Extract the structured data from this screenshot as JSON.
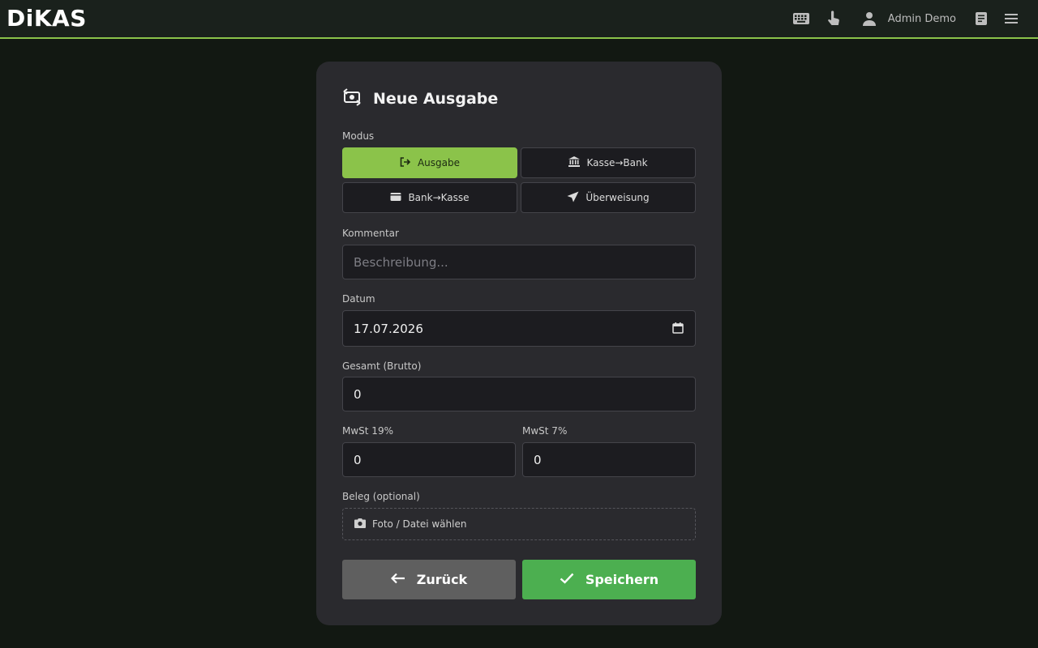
{
  "header": {
    "logo_text": "DiKAS",
    "user_name": "Admin Demo",
    "icons": [
      "keyboard-icon",
      "touch-icon",
      "user-icon",
      "book-icon",
      "menu-icon"
    ]
  },
  "form": {
    "title": "Neue Ausgabe",
    "title_icon": "money-exchange-icon",
    "mode_label": "Modus",
    "modes": [
      {
        "label": "Ausgabe",
        "icon": "logout-icon",
        "active": true
      },
      {
        "label": "Kasse→Bank",
        "icon": "bank-icon",
        "active": false
      },
      {
        "label": "Bank→Kasse",
        "icon": "wallet-icon",
        "active": false
      },
      {
        "label": "Überweisung",
        "icon": "send-icon",
        "active": false
      }
    ],
    "comment_label": "Kommentar",
    "comment_placeholder": "Beschreibung...",
    "date_label": "Datum",
    "date_value": "17.07.2026",
    "gross_label": "Gesamt (Brutto)",
    "gross_value": "0",
    "vat19_label": "MwSt 19%",
    "vat19_value": "0",
    "vat7_label": "MwSt 7%",
    "vat7_value": "0",
    "receipt_label": "Beleg (optional)",
    "receipt_button": "Foto / Datei wählen",
    "back_label": "Zurück",
    "save_label": "Speichern"
  },
  "colors": {
    "accent": "#8bc34a",
    "save": "#4caf50",
    "back": "#5f5f5f",
    "card": "#2a2a2e",
    "background": "#121812"
  }
}
